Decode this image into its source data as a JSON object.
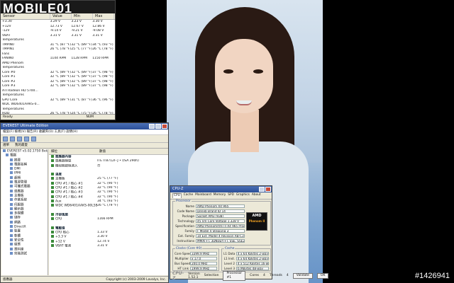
{
  "logo": {
    "text": "MOBILE01"
  },
  "hwmonitor": {
    "columns": [
      "Sensor",
      "Value",
      "Min",
      "Max"
    ],
    "rows": [
      [
        "+3.3V",
        "3.29 V",
        "3.23 V",
        "3.30 V"
      ],
      [
        "+12V",
        "12.73 V",
        "12.67 V",
        "12.86 V"
      ],
      [
        "-12V",
        "-9.14 V",
        "-9.21 V",
        "-9.08 V"
      ],
      [
        "VBAT",
        "3.31 V",
        "3.31 V",
        "3.31 V"
      ],
      [
        "Temperatures",
        "",
        "",
        ""
      ],
      [
        "TMPIN0",
        "31 °C (87 °F)",
        "32 °C (89 °F)",
        "34 °C (93 °F)"
      ],
      [
        "TMPIN1",
        "26 °C (78 °F)",
        "25 °C (77 °F)",
        "26 °C (78 °F)"
      ],
      [
        "Fans",
        "",
        "",
        ""
      ],
      [
        "FANIN0",
        "1144 RPM",
        "1128 RPM",
        "1150 RPM"
      ],
      [
        "AMD Phenom",
        "",
        "",
        ""
      ],
      [
        "Temperatures",
        "",
        "",
        ""
      ],
      [
        "Core #0",
        "32 °C (89 °F)",
        "32 °C (89 °F)",
        "37 °C (98 °F)"
      ],
      [
        "Core #1",
        "32 °C (89 °F)",
        "32 °C (89 °F)",
        "37 °C (98 °F)"
      ],
      [
        "Core #2",
        "32 °C (89 °F)",
        "32 °C (89 °F)",
        "37 °C (98 °F)"
      ],
      [
        "Core #3",
        "32 °C (89 °F)",
        "32 °C (89 °F)",
        "37 °C (98 °F)"
      ],
      [
        "ATI Radeon HD 5700...",
        "",
        "",
        ""
      ],
      [
        "Temperatures",
        "",
        "",
        ""
      ],
      [
        "GPU Core",
        "32 °C (89 °F)",
        "31 °C (87 °F)",
        "36 °C (96 °F)"
      ],
      [
        "WDC WD6401AAKS-0...",
        "",
        "",
        ""
      ],
      [
        "Temperatures",
        "",
        "",
        ""
      ],
      [
        "HDD",
        "26 °C (78 °F)",
        "24 °C (75 °F)",
        "26 °C (78 °F)"
      ]
    ],
    "status_left": "Ready",
    "status_right": "NUM"
  },
  "everest": {
    "title": "EVEREST Ultimate Edition",
    "menu": "檔案(F)  檢視(V)  報告(R)  收藏夾(O)  工具(T)  說明(H)",
    "tabs": [
      "選單",
      "我的最愛"
    ],
    "tree": [
      "EVEREST v5.02.1750 Beta",
      "電腦",
      "摘要",
      "電腦名稱",
      "DMI",
      "IPMI",
      "超頻",
      "電源管理",
      "可攜式電腦",
      "感應器",
      "主機板",
      "作業系統",
      "伺服器",
      "顯示器",
      "多媒體",
      "儲存",
      "網路",
      "DirectX",
      "裝置",
      "軟體",
      "安全性",
      "組態",
      "資料庫",
      "效能測試"
    ],
    "header": [
      "欄位",
      "數值"
    ],
    "rows": [
      {
        "k": "感應器內容",
        "v": "",
        "sec": true
      },
      {
        "k": "感應器類型",
        "v": "ITE IT8712F-J • (ISA 290h)",
        "sec": false
      },
      {
        "k": "機殼開啟偵測入",
        "v": "否",
        "sec": false
      },
      {
        "k": "",
        "v": "",
        "sec": false
      },
      {
        "k": "溫度",
        "v": "",
        "sec": true
      },
      {
        "k": "主機板",
        "v": "25 °C  (77 °F)",
        "sec": false
      },
      {
        "k": "CPU #1 / 核心 #1",
        "v": "32 °C  (90 °F)",
        "sec": false
      },
      {
        "k": "CPU #1 / 核心 #2",
        "v": "32 °C  (90 °F)",
        "sec": false
      },
      {
        "k": "CPU #1 / 核心 #3",
        "v": "32 °C  (90 °F)",
        "sec": false
      },
      {
        "k": "CPU #1 / 核心 #4",
        "v": "32 °C  (90 °F)",
        "sec": false
      },
      {
        "k": "Aux",
        "v": "34 °C  (93 °F)",
        "sec": false
      },
      {
        "k": "WDC WD6401AAKS-00L5B2",
        "v": "26 °C  (79 °F)",
        "sec": false
      },
      {
        "k": "",
        "v": "",
        "sec": false
      },
      {
        "k": "冷卻風扇",
        "v": "",
        "sec": true
      },
      {
        "k": "CPU",
        "v": "1166 RPM",
        "sec": false
      },
      {
        "k": "",
        "v": "",
        "sec": false
      },
      {
        "k": "電壓值",
        "v": "",
        "sec": true
      },
      {
        "k": "CPU 核心",
        "v": "1.33 V",
        "sec": false
      },
      {
        "k": "+3.3 V",
        "v": "3.30 V",
        "sec": false
      },
      {
        "k": "+12 V",
        "v": "12.74 V",
        "sec": false
      },
      {
        "k": "VBAT 電池",
        "v": "3.31 V",
        "sec": false
      }
    ],
    "status_left": "感應器",
    "status_right": "Copyright (c) 2003-2009 Lavalys, Inc."
  },
  "cpuz": {
    "title": "CPU-Z",
    "tabs": [
      "CPU",
      "Cache",
      "Mainboard",
      "Memory",
      "SPD",
      "Graphics",
      "About"
    ],
    "processor_title": "Processor",
    "processor": [
      [
        "Name",
        "AMD Phenom X4 965"
      ],
      [
        "Code Name",
        "Deneb        Brand ID   14"
      ],
      [
        "Package",
        "Socket AM3 (938)"
      ],
      [
        "Technology",
        "45 nm    Core Voltage   1.328 V"
      ],
      [
        "Specification",
        "AMD Phenom(tm) II X4 965 Processor"
      ],
      [
        "Family",
        "F     Model  4    Stepping  3"
      ],
      [
        "Ext. Family",
        "10   Ext. Model  4   Revision  RB-C3"
      ],
      [
        "Instructions",
        "MMX(+), 3DNow!(+), SSE, SSE2, SSE3, SSE4A, x86-64"
      ]
    ],
    "amd_text": "AMD",
    "amd_sub": "Phenom II",
    "clocks_title": "Clocks (Core #0)",
    "clocks": [
      [
        "Core Speed",
        "3399.9 MHz"
      ],
      [
        "Multiplier",
        "x 17.0"
      ],
      [
        "Bus Speed",
        "200.0 MHz"
      ],
      [
        "HT Link",
        "1999.9 MHz"
      ]
    ],
    "cache_title": "Cache",
    "cache": [
      [
        "L1 Data",
        "4 x 64 KBytes   2-way"
      ],
      [
        "L1 Inst.",
        "4 x 64 KBytes   2-way"
      ],
      [
        "Level 2",
        "4 x 512 KBytes  16-way"
      ],
      [
        "Level 3",
        "6 MBytes   48-way"
      ]
    ],
    "selection_label": "Selection",
    "selection_value": "Processor #1",
    "cores_label": "Cores",
    "cores_value": "4",
    "threads_label": "Threads",
    "threads_value": "4",
    "brand": "CPU-Z",
    "version": "Version 1.52.1",
    "validate": "Validate",
    "ok": "OK"
  },
  "watermark": "#1426941"
}
